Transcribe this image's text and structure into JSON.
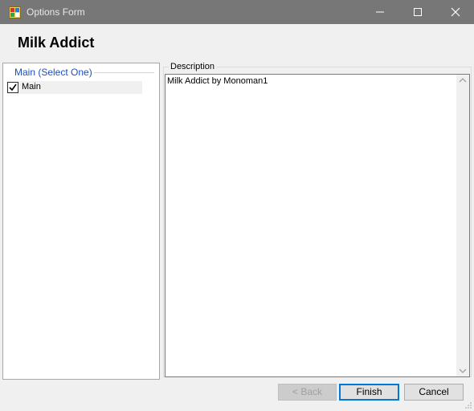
{
  "window": {
    "title": "Options Form"
  },
  "heading": "Milk Addict",
  "options_group": {
    "title": "Main (Select One)",
    "items": [
      {
        "label": "Main",
        "checked": true
      }
    ]
  },
  "description": {
    "label": "Description",
    "text": "Milk Addict by Monoman1"
  },
  "buttons": {
    "back": "< Back",
    "finish": "Finish",
    "cancel": "Cancel"
  },
  "colors": {
    "titlebar": "#777777",
    "group_title": "#1e4fb8",
    "focus_border": "#0078d7"
  }
}
